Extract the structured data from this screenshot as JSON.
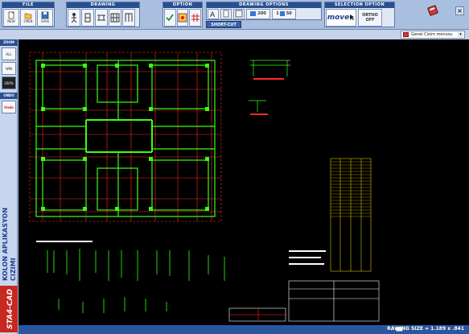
{
  "toolbar": {
    "file_title": "FILE",
    "file_buttons": [
      "NEW",
      "OPEN",
      "SAVE"
    ],
    "drawing_title": "DRAWING",
    "option_title": "OPTION",
    "drawing_options_title": "DRAWING OPTIONS",
    "scale_200": "200",
    "scale_1": "1",
    "scale_50": "50",
    "selection_title": "SELECTION OPTION",
    "move_label": "move",
    "ortho_label": "ORTHO",
    "ortho_state": "OFF",
    "shortcut_label": "SHORT-CUT"
  },
  "menu_select": {
    "value": "Genel Cizim menusu"
  },
  "left_panel": {
    "zoom_title": "ZOOM",
    "zoom_buttons": [
      "ALL",
      "WIN",
      "200%"
    ],
    "undo_title": "UNDO",
    "undo_label": "Undo",
    "brand": "STA4-CAD",
    "caption_line1": "KOLON APLIKASYON",
    "caption_line2": "CIZIMI"
  },
  "status": {
    "drawing_size": "RAWING SIZE = 1.189 x .841"
  },
  "colors": {
    "canvas_bg": "#000000",
    "grid_red": "#ff2a2a",
    "column_green": "#39ff14",
    "table_yellow": "#ffe600",
    "text_white": "#ffffff",
    "toolbar_blue": "#2a4f8f"
  }
}
